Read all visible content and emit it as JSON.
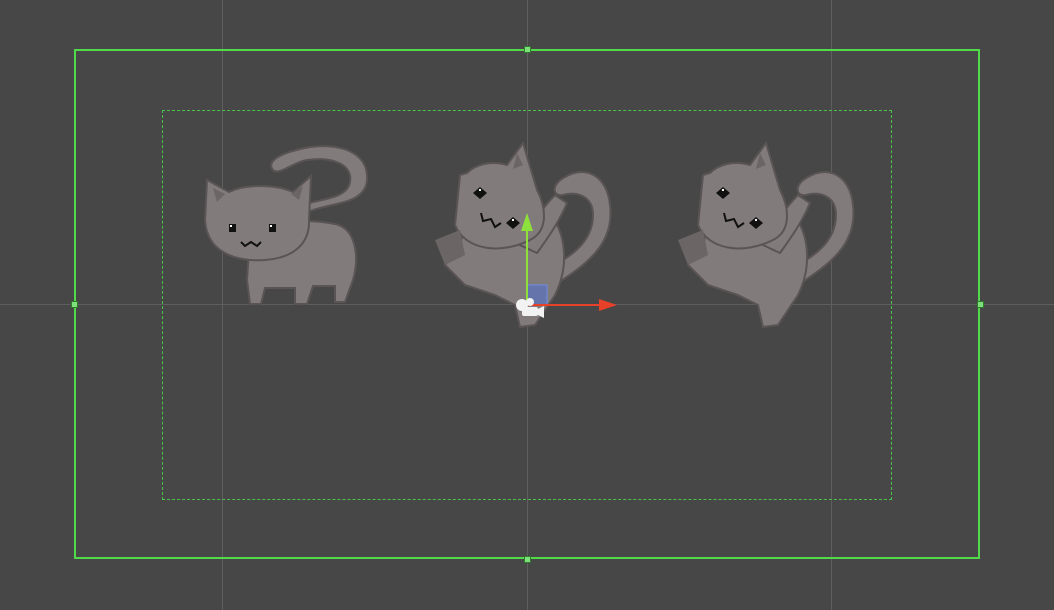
{
  "scene": {
    "background_color": "#474747",
    "grid_color": "#5e5e5e",
    "camera_bounds_color": "#52d94a",
    "safe_area_color": "#49c24a"
  },
  "sprites": [
    {
      "name": "cat-sitting",
      "pose": "sitting",
      "color": "#827b7c",
      "shade": "#6b6565"
    },
    {
      "name": "cat-leaping-selected",
      "pose": "leaping",
      "color": "#827b7c",
      "shade": "#6b6565"
    },
    {
      "name": "cat-leaping",
      "pose": "leaping",
      "color": "#827b7c",
      "shade": "#6b6565"
    }
  ],
  "gizmo": {
    "type": "move-tool",
    "x_axis_color": "#e8412a",
    "y_axis_color": "#8ee03c",
    "plane_handle_color": "#4f6fcf"
  }
}
